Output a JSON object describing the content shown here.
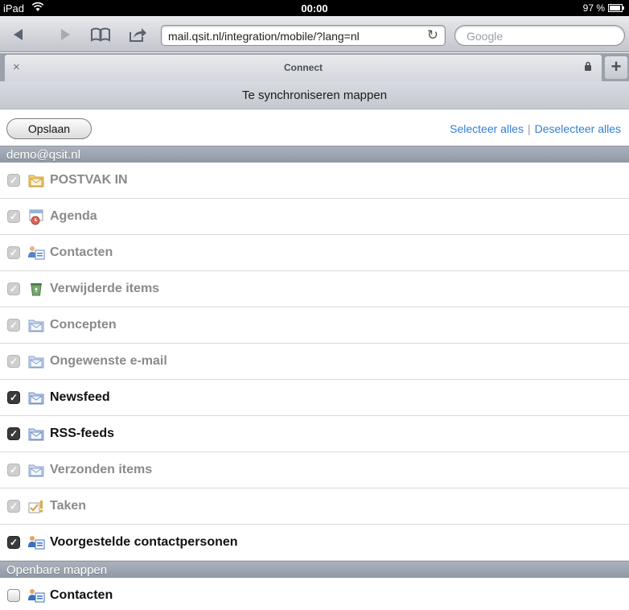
{
  "statusbar": {
    "device": "iPad",
    "time": "00:00",
    "battery": "97 %"
  },
  "browser": {
    "url": "mail.qsit.nl/integration/mobile/?lang=nl",
    "search_placeholder": "Google",
    "tab_title": "Connect",
    "tab_close": "×",
    "new_tab": "+"
  },
  "page": {
    "title": "Te synchroniseren mappen",
    "save_label": "Opslaan",
    "select_all": "Selecteer alles",
    "separator": "|",
    "deselect_all": "Deselecteer alles"
  },
  "sections": [
    {
      "header": "demo@qsit.nl",
      "folders": [
        {
          "label": "POSTVAK IN",
          "icon": "inbox-folder-icon",
          "checked": true,
          "enabled": false
        },
        {
          "label": "Agenda",
          "icon": "calendar-icon",
          "checked": true,
          "enabled": false
        },
        {
          "label": "Contacten",
          "icon": "contacts-icon",
          "checked": true,
          "enabled": false
        },
        {
          "label": "Verwijderde items",
          "icon": "trash-icon",
          "checked": true,
          "enabled": false
        },
        {
          "label": "Concepten",
          "icon": "mail-folder-icon",
          "checked": true,
          "enabled": false
        },
        {
          "label": "Ongewenste e-mail",
          "icon": "mail-folder-icon",
          "checked": true,
          "enabled": false
        },
        {
          "label": "Newsfeed",
          "icon": "mail-folder-icon",
          "checked": true,
          "enabled": true
        },
        {
          "label": "RSS-feeds",
          "icon": "mail-folder-icon",
          "checked": true,
          "enabled": true
        },
        {
          "label": "Verzonden items",
          "icon": "mail-folder-icon",
          "checked": true,
          "enabled": false
        },
        {
          "label": "Taken",
          "icon": "tasks-icon",
          "checked": true,
          "enabled": false
        },
        {
          "label": "Voorgestelde contactpersonen",
          "icon": "contacts-icon",
          "checked": true,
          "enabled": true
        }
      ]
    },
    {
      "header": "Openbare mappen",
      "folders": [
        {
          "label": "Contacten",
          "icon": "contacts-icon",
          "checked": false,
          "enabled": true
        }
      ]
    }
  ]
}
